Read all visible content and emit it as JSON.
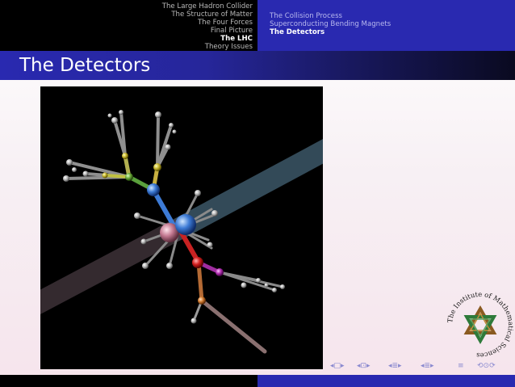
{
  "headline": {
    "sections": [
      {
        "label": "The Large Hadron Collider",
        "active": false
      },
      {
        "label": "The Structure of Matter",
        "active": false
      },
      {
        "label": "The Four Forces",
        "active": false
      },
      {
        "label": "Final Picture",
        "active": false
      },
      {
        "label": "The LHC",
        "active": true
      },
      {
        "label": "Theory Issues",
        "active": false
      }
    ],
    "subsections": [
      {
        "label": "The Collision Process",
        "active": false
      },
      {
        "label": "Superconducting Bending Magnets",
        "active": false
      },
      {
        "label": "The Detectors",
        "active": true
      }
    ]
  },
  "frame": {
    "title": "The Detectors"
  },
  "logo": {
    "text": "The Institute of Mathematical Sciences"
  },
  "navigation": {
    "icons": [
      "frame-back-icon",
      "frame-forward-icon",
      "subsection-back-icon",
      "subsection-forward-icon",
      "section-back-icon",
      "section-forward-icon",
      "document-icon",
      "search-icon"
    ]
  },
  "colors": {
    "headline_left": "#000000",
    "headline_right": "#2929b0",
    "title_text": "#ffffff"
  }
}
